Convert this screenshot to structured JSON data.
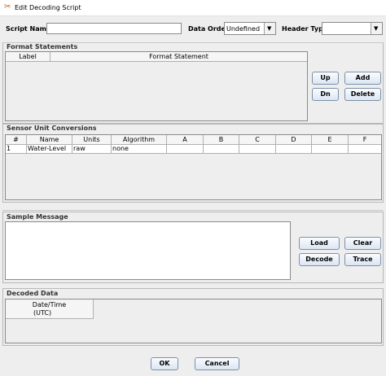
{
  "window": {
    "title": "Edit Decoding Script"
  },
  "header": {
    "script_name_label": "Script Name:",
    "script_name_value": "",
    "data_order_label": "Data Order:",
    "data_order_value": "Undefined",
    "header_type_label": "Header Type",
    "header_type_value": ""
  },
  "format_statements": {
    "title": "Format Statements",
    "columns": [
      "Label",
      "Format Statement"
    ],
    "buttons": {
      "up": "Up",
      "add": "Add",
      "dn": "Dn",
      "delete": "Delete"
    }
  },
  "sensor_conversions": {
    "title": "Sensor Unit Conversions",
    "columns": [
      "#",
      "Name",
      "Units",
      "Algorithm",
      "A",
      "B",
      "C",
      "D",
      "E",
      "F"
    ],
    "rows": [
      [
        "1",
        "Water-Level",
        "raw",
        "none",
        "",
        "",
        "",
        "",
        "",
        ""
      ]
    ]
  },
  "sample_message": {
    "title": "Sample Message",
    "value": "",
    "buttons": {
      "load": "Load",
      "clear": "Clear",
      "decode": "Decode",
      "trace": "Trace"
    }
  },
  "decoded_data": {
    "title": "Decoded Data",
    "columns": [
      "Date/Time",
      "(UTC)"
    ]
  },
  "footer": {
    "ok": "OK",
    "cancel": "Cancel"
  }
}
